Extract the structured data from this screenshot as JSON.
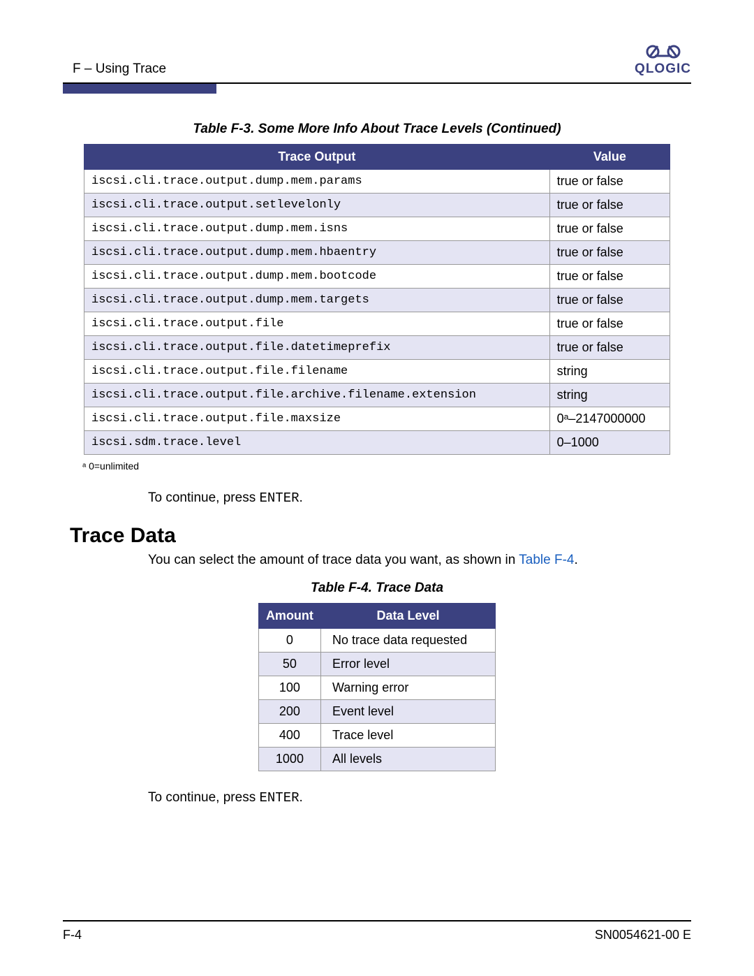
{
  "header": {
    "section": "F – Using Trace",
    "logo_text": "QLOGIC"
  },
  "table1": {
    "caption": "Table F-3. Some More Info About Trace Levels (Continued)",
    "headers": [
      "Trace Output",
      "Value"
    ],
    "rows": [
      {
        "output": "iscsi.cli.trace.output.dump.mem.params",
        "value": "true or false"
      },
      {
        "output": "iscsi.cli.trace.output.setlevelonly",
        "value": "true or false"
      },
      {
        "output": "iscsi.cli.trace.output.dump.mem.isns",
        "value": "true or false"
      },
      {
        "output": "iscsi.cli.trace.output.dump.mem.hbaentry",
        "value": "true or false"
      },
      {
        "output": "iscsi.cli.trace.output.dump.mem.bootcode",
        "value": "true or false"
      },
      {
        "output": "iscsi.cli.trace.output.dump.mem.targets",
        "value": "true or false"
      },
      {
        "output": "iscsi.cli.trace.output.file",
        "value": "true or false"
      },
      {
        "output": "iscsi.cli.trace.output.file.datetimeprefix",
        "value": "true or false"
      },
      {
        "output": "iscsi.cli.trace.output.file.filename",
        "value": "string"
      },
      {
        "output": "iscsi.cli.trace.output.file.archive.filename.extension",
        "value": "string"
      },
      {
        "output": "iscsi.cli.trace.output.file.maxsize",
        "value": "0ᵃ–2147000000"
      },
      {
        "output": "iscsi.sdm.trace.level",
        "value": "0–1000"
      }
    ],
    "footnote": "ᵃ 0=unlimited"
  },
  "continue1": {
    "prefix": "To continue, press ",
    "key": "ENTER",
    "suffix": "."
  },
  "section": {
    "heading": "Trace Data",
    "intro_prefix": "You can select the amount of trace data you want, as shown in ",
    "intro_xref": "Table F-4",
    "intro_suffix": "."
  },
  "table2": {
    "caption": "Table F-4. Trace Data",
    "headers": [
      "Amount",
      "Data Level"
    ],
    "rows": [
      {
        "amount": "0",
        "level": "No trace data requested"
      },
      {
        "amount": "50",
        "level": "Error level"
      },
      {
        "amount": "100",
        "level": "Warning error"
      },
      {
        "amount": "200",
        "level": "Event level"
      },
      {
        "amount": "400",
        "level": "Trace level"
      },
      {
        "amount": "1000",
        "level": "All levels"
      }
    ]
  },
  "continue2": {
    "prefix": "To continue, press ",
    "key": "ENTER",
    "suffix": "."
  },
  "footer": {
    "page": "F-4",
    "docnum": "SN0054621-00  E"
  }
}
